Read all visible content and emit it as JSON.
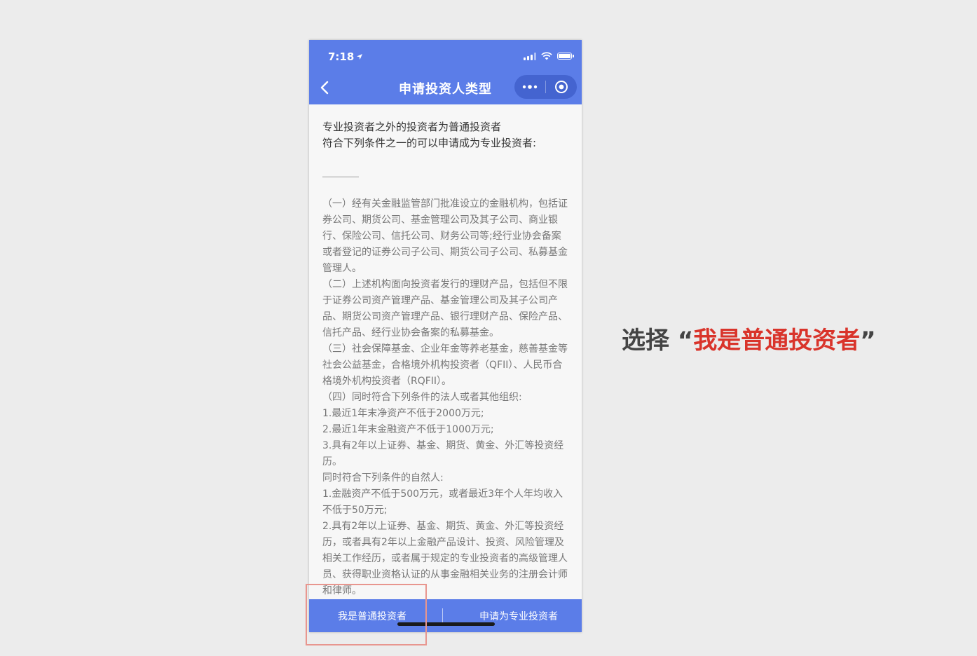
{
  "status_bar": {
    "time": "7:18"
  },
  "nav": {
    "title": "申请投资人类型"
  },
  "content": {
    "intro": [
      "专业投资者之外的投资者为普通投资者",
      "符合下列条件之一的可以申请成为专业投资者:"
    ],
    "paragraphs": [
      "（一）经有关金融监管部门批准设立的金融机构，包括证券公司、期货公司、基金管理公司及其子公司、商业银行、保险公司、信托公司、财务公司等;经行业协会备案或者登记的证券公司子公司、期货公司子公司、私募基金管理人。",
      "（二）上述机构面向投资者发行的理财产品，包括但不限于证券公司资产管理产品、基金管理公司及其子公司产品、期货公司资产管理产品、银行理财产品、保险产品、信托产品、经行业协会备案的私募基金。",
      "（三）社会保障基金、企业年金等养老基金，慈善基金等社会公益基金，合格境外机构投资者（QFII）、人民币合格境外机构投资者（RQFII）。",
      "（四）同时符合下列条件的法人或者其他组织:",
      "1.最近1年末净资产不低于2000万元;",
      "2.最近1年末金融资产不低于1000万元;",
      "3.具有2年以上证券、基金、期货、黄金、外汇等投资经历。",
      "同时符合下列条件的自然人:",
      "1.金融资产不低于500万元，或者最近3年个人年均收入不低于50万元;",
      "2.具有2年以上证券、基金、期货、黄金、外汇等投资经历，或者具有2年以上金融产品设计、投资、风险管理及相关工作经历，或者属于规定的专业投资者的高级管理人员、获得职业资格认证的从事金融相关业务的注册会计师和律师。"
    ]
  },
  "bottom_bar": {
    "left_label": "我是普通投资者",
    "right_label": "申请为专业投资者"
  },
  "callout": {
    "prefix": "选择 “",
    "highlight": "我是普通投资者",
    "suffix": "”"
  },
  "colors": {
    "header_bg": "#5b7de8",
    "accent_red": "#d9342b",
    "highlight_border": "#e8968f"
  },
  "icons": [
    "back-icon",
    "more-icon",
    "target-icon",
    "location-arrow-icon",
    "signal-icon",
    "wifi-icon",
    "battery-icon"
  ]
}
